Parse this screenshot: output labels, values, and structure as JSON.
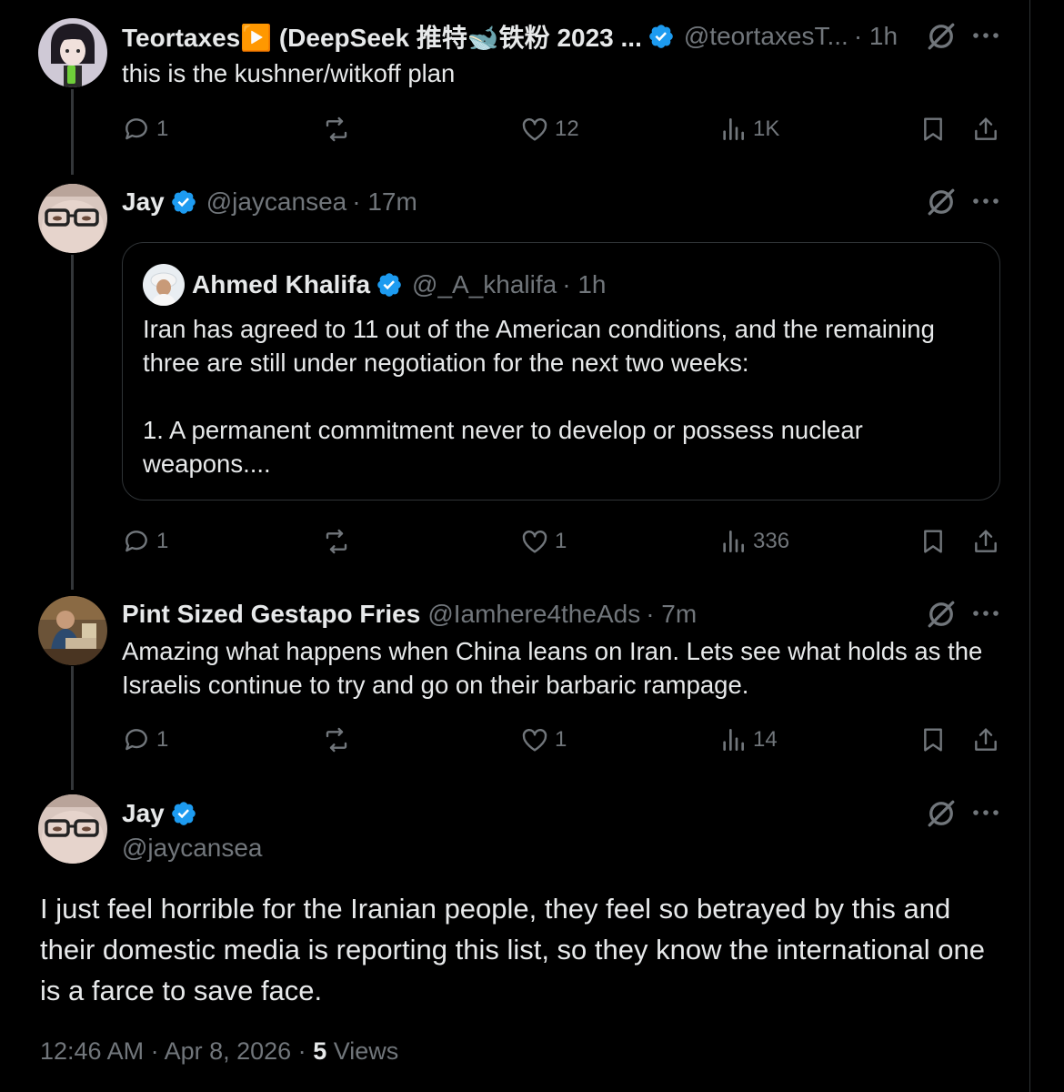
{
  "tweets": [
    {
      "name": "Teortaxes▶️ (DeepSeek 推特🐋铁粉 2023 ...",
      "handle": "@teortaxesT...",
      "time": "· 1h",
      "text": "this is the kushner/witkoff plan",
      "replies": "1",
      "reposts": "",
      "likes": "12",
      "views": "1K"
    },
    {
      "name": "Jay",
      "handle": "@jaycansea",
      "time": "· 17m",
      "text": "",
      "replies": "1",
      "reposts": "",
      "likes": "1",
      "views": "336"
    },
    {
      "name": "Pint Sized Gestapo Fries",
      "handle": "@Iamhere4theAds",
      "time": "· 7m",
      "text": "Amazing what happens when China leans on Iran. Lets see what holds as the Israelis continue to try and go on their barbaric rampage.",
      "replies": "1",
      "reposts": "",
      "likes": "1",
      "views": "14"
    }
  ],
  "quote": {
    "name": "Ahmed Khalifa",
    "handle": "@_A_khalifa",
    "time": "· 1h",
    "text": "Iran has agreed to 11 out of the American conditions, and the remaining three are still under negotiation for the next two weeks:\n\n1.  A permanent commitment never to develop or possess nuclear weapons...."
  },
  "main_tweet": {
    "name": "Jay",
    "handle": "@jaycansea",
    "text": "I just feel horrible for the Iranian people, they feel so betrayed by this and their domestic media is reporting this list, so they know the international one is a farce to save face.",
    "timestamp": "12:46 AM · Apr 8, 2026 ·",
    "views_count": "5",
    "views_label": "Views"
  },
  "icons": {
    "reply": "reply-icon",
    "repost": "repost-icon",
    "like": "heart-icon",
    "views": "views-chart-icon",
    "bookmark": "bookmark-icon",
    "share": "share-icon",
    "grok": "grok-icon",
    "more": "more-dots-icon",
    "verified": "verified-badge-icon"
  },
  "colors": {
    "background": "#000000",
    "text": "#e7e9ea",
    "muted": "#71767b",
    "verified": "#1d9bf0",
    "border": "#2f3336"
  }
}
